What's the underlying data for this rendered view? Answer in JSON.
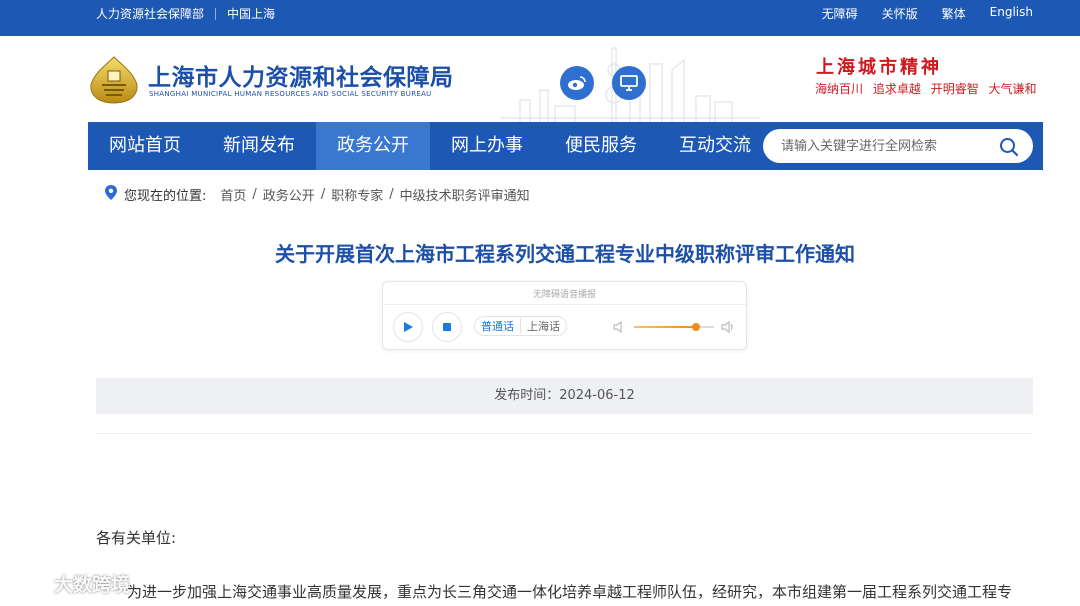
{
  "topbar": {
    "left_links": [
      "人力资源社会保障部",
      "中国上海"
    ],
    "right_links": [
      "无障碍",
      "关怀版",
      "繁体",
      "English"
    ]
  },
  "header": {
    "logo_cn": "上海市人力资源和社会保障局",
    "logo_en": "SHANGHAI MUNICIPAL HUMAN RESOURCES AND SOCIAL SECURITY BUREAU",
    "social_icons": [
      "weibo-icon",
      "monitor-icon"
    ],
    "city_spirit": {
      "title": "上海城市精神",
      "slogans": [
        "海纳百川",
        "追求卓越",
        "开明睿智",
        "大气谦和"
      ]
    }
  },
  "nav": {
    "items": [
      {
        "label": "网站首页",
        "active": false
      },
      {
        "label": "新闻发布",
        "active": false
      },
      {
        "label": "政务公开",
        "active": true
      },
      {
        "label": "网上办事",
        "active": false
      },
      {
        "label": "便民服务",
        "active": false
      },
      {
        "label": "互动交流",
        "active": false
      }
    ],
    "search_placeholder": "请输入关键字进行全网检索"
  },
  "breadcrumb": {
    "label": "您现在的位置:",
    "items": [
      "首页",
      "政务公开",
      "职称专家",
      "中级技术职务评审通知"
    ]
  },
  "article": {
    "title": "关于开展首次上海市工程系列交通工程专业中级职称评审工作通知",
    "publish_text": "发布时间：2024-06-12",
    "greeting": "各有关单位:",
    "paragraph": "为进一步加强上海交通事业高质量发展，重点为长三角交通一体化培养卓越工程师队伍，经研究，本市组建第一届工程系列交通工程专"
  },
  "player": {
    "title": "无障碍语音播报",
    "dialect_options": [
      "普通话",
      "上海话"
    ],
    "selected_dialect": "普通话",
    "volume": 0.78,
    "colors": {
      "accent": "#1a7ae0",
      "volume": "#f08a1a"
    }
  },
  "watermark": {
    "text": "大数跨境"
  },
  "colors": {
    "brand_blue": "#1c58b4",
    "nav_active": "#3a78d0",
    "title_blue": "#1c4fa8",
    "spirit_red": "#d0191f"
  }
}
